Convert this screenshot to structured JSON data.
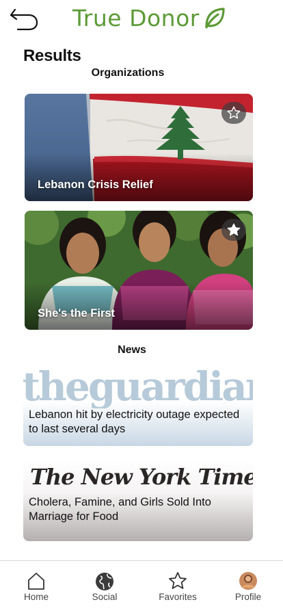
{
  "header": {
    "back_icon": "undo-arrow-icon",
    "brand_name": "True Donor",
    "brand_icon": "leaf-icon",
    "brand_color": "#5c9a36"
  },
  "results_title": "Results",
  "organizations": {
    "section_title": "Organizations",
    "items": [
      {
        "name": "Lebanon Crisis Relief",
        "image": "lebanon-flag-photo",
        "favorited": false
      },
      {
        "name": "She's the First",
        "image": "three-girls-photo",
        "favorited": true
      }
    ]
  },
  "news": {
    "section_title": "News",
    "items": [
      {
        "source": "theguardian",
        "headline": "Lebanon hit by electricity outage expected to last several days"
      },
      {
        "source": "The New York Times",
        "headline": "Cholera, Famine, and Girls Sold Into Marriage for Food"
      }
    ]
  },
  "bottom_nav": [
    {
      "label": "Home",
      "icon": "home-icon"
    },
    {
      "label": "Social",
      "icon": "globe-icon"
    },
    {
      "label": "Favorites",
      "icon": "star-icon"
    },
    {
      "label": "Profile",
      "icon": "avatar-icon"
    }
  ]
}
